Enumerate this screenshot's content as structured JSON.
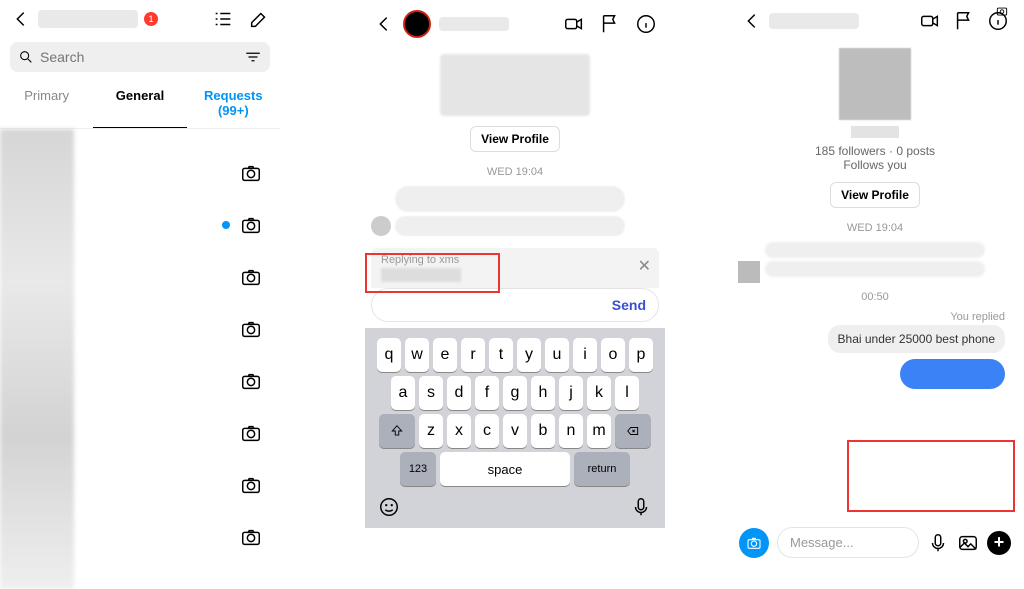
{
  "panel1": {
    "notification_count": "1",
    "search_placeholder": "Search",
    "tabs": {
      "primary": "Primary",
      "general": "General",
      "requests": "Requests (99+)"
    }
  },
  "panel2": {
    "view_profile": "View Profile",
    "timestamp": "WED 19:04",
    "replying_label": "Replying to xms",
    "send_label": "Send",
    "keyboard": {
      "row1": [
        "q",
        "w",
        "e",
        "r",
        "t",
        "y",
        "u",
        "i",
        "o",
        "p"
      ],
      "row2": [
        "a",
        "s",
        "d",
        "f",
        "g",
        "h",
        "j",
        "k",
        "l"
      ],
      "row3": [
        "z",
        "x",
        "c",
        "v",
        "b",
        "n",
        "m"
      ],
      "num_key": "123",
      "space_key": "space",
      "return_key": "return"
    }
  },
  "panel3": {
    "meta_line1": "185 followers · 0 posts",
    "meta_line2": "Follows you",
    "view_profile": "View Profile",
    "timestamp1": "WED 19:04",
    "timestamp2": "00:50",
    "you_replied": "You replied",
    "quoted_message": "Bhai under 25000 best phone",
    "compose_placeholder": "Message..."
  }
}
